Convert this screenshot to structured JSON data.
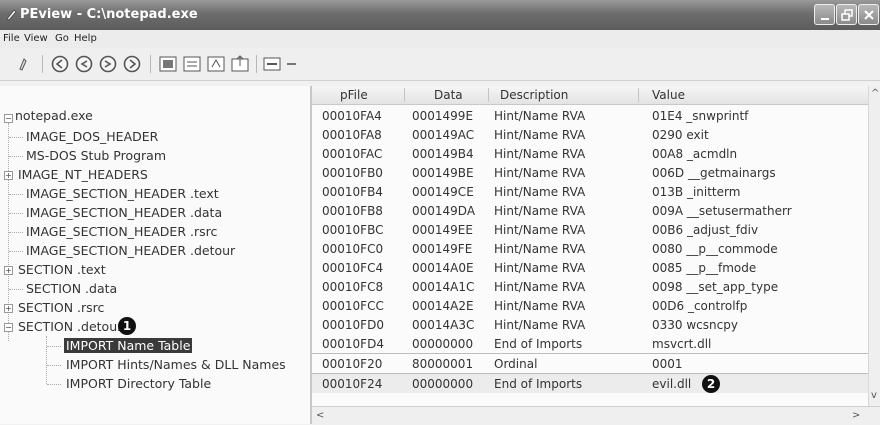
{
  "window": {
    "title": "PEview - C:\\notepad.exe"
  },
  "menu": {
    "file": "File",
    "view": "View",
    "go": "Go",
    "help": "Help"
  },
  "tree": {
    "root": "notepad.exe",
    "items": [
      "IMAGE_DOS_HEADER",
      "MS-DOS Stub Program",
      "IMAGE_NT_HEADERS",
      "IMAGE_SECTION_HEADER .text",
      "IMAGE_SECTION_HEADER .data",
      "IMAGE_SECTION_HEADER .rsrc",
      "IMAGE_SECTION_HEADER .detour",
      "SECTION .text",
      "SECTION .data",
      "SECTION .rsrc",
      "SECTION .detour"
    ],
    "children": [
      "IMPORT Name Table",
      "IMPORT Hints/Names & DLL Names",
      "IMPORT Directory Table"
    ],
    "callout": "1"
  },
  "table": {
    "columns": [
      "pFile",
      "Data",
      "Description",
      "Value"
    ],
    "rows": [
      [
        "00010FA4",
        "0001499E",
        "Hint/Name RVA",
        "01E4  _snwprintf"
      ],
      [
        "00010FA8",
        "000149AC",
        "Hint/Name RVA",
        "0290  exit"
      ],
      [
        "00010FAC",
        "000149B4",
        "Hint/Name RVA",
        "00A8  _acmdln"
      ],
      [
        "00010FB0",
        "000149BE",
        "Hint/Name RVA",
        "006D  __getmainargs"
      ],
      [
        "00010FB4",
        "000149CE",
        "Hint/Name RVA",
        "013B  _initterm"
      ],
      [
        "00010FB8",
        "000149DA",
        "Hint/Name RVA",
        "009A  __setusermatherr"
      ],
      [
        "00010FBC",
        "000149EE",
        "Hint/Name RVA",
        "00B6  _adjust_fdiv"
      ],
      [
        "00010FC0",
        "000149FE",
        "Hint/Name RVA",
        "0080  __p__commode"
      ],
      [
        "00010FC4",
        "00014A0E",
        "Hint/Name RVA",
        "0085  __p__fmode"
      ],
      [
        "00010FC8",
        "00014A1C",
        "Hint/Name RVA",
        "0098  __set_app_type"
      ],
      [
        "00010FCC",
        "00014A2E",
        "Hint/Name RVA",
        "00D6  _controlfp"
      ],
      [
        "00010FD0",
        "00014A3C",
        "Hint/Name RVA",
        "0330  wcsncpy"
      ],
      [
        "00010FD4",
        "00000000",
        "End of Imports",
        "msvcrt.dll"
      ],
      [
        "00010F20",
        "80000001",
        "Ordinal",
        "0001"
      ],
      [
        "00010F24",
        "00000000",
        "End of Imports",
        "evil.dll"
      ]
    ],
    "callout": "2"
  },
  "toolbar_icons": [
    "open-icon",
    "back-circle-icon",
    "back-circle-icon-2",
    "forward-circle-icon",
    "forward-circle-icon-2",
    "view-hex-icon",
    "view-record-icon",
    "view-text-icon",
    "view-export-icon",
    "view-bytes-icon",
    "view-dash-icon"
  ]
}
